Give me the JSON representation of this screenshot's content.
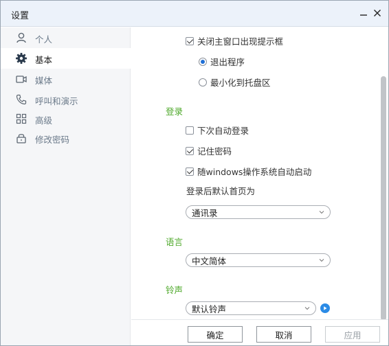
{
  "window": {
    "title": "设置",
    "minimize_glyph": "—",
    "close_glyph": "✕"
  },
  "sidebar": {
    "items": [
      {
        "label": "个人",
        "icon": "person-icon",
        "active": false
      },
      {
        "label": "基本",
        "icon": "gear-icon",
        "active": true
      },
      {
        "label": "媒体",
        "icon": "camera-icon",
        "active": false
      },
      {
        "label": "呼叫和演示",
        "icon": "phone-icon",
        "active": false
      },
      {
        "label": "高级",
        "icon": "grid-icon",
        "active": false
      },
      {
        "label": "修改密码",
        "icon": "lock-icon",
        "active": false
      }
    ]
  },
  "content": {
    "close_prompt": {
      "label": "关闭主窗口出现提示框",
      "checked": true
    },
    "close_options": [
      {
        "label": "退出程序",
        "selected": true
      },
      {
        "label": "最小化到托盘区",
        "selected": false
      }
    ],
    "login_section": "登录",
    "auto_login": {
      "label": "下次自动登录",
      "checked": false
    },
    "remember_pwd": {
      "label": "记住密码",
      "checked": true
    },
    "auto_start": {
      "label": "随windows操作系统自动启动",
      "checked": true
    },
    "default_home_label": "登录后默认首页为",
    "default_home_value": "通讯录",
    "language_section": "语言",
    "language_value": "中文简体",
    "ringtone_section": "铃声",
    "ringtone_value": "默认铃声"
  },
  "footer": {
    "ok": "确定",
    "cancel": "取消",
    "apply": "应用"
  },
  "colors": {
    "section_green": "#4ea82a",
    "accent_blue": "#2b8be6"
  }
}
